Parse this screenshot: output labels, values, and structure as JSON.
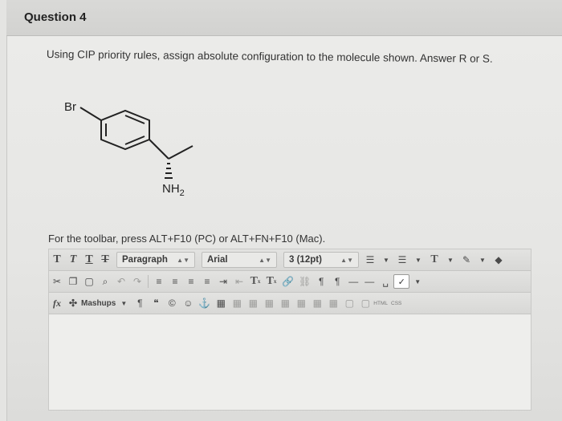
{
  "question": {
    "title": "Question 4",
    "text": "Using CIP priority rules, assign absolute configuration to the molecule shown. Answer R or S."
  },
  "molecule": {
    "labels": {
      "br": "Br",
      "nh2": "NH",
      "nh2_sub": "2"
    }
  },
  "editor": {
    "toolbar_hint": "For the toolbar, press ALT+F10 (PC) or ALT+FN+F10 (Mac).",
    "row1": {
      "format_buttons": [
        "T",
        "T",
        "T",
        "T"
      ],
      "paragraph": "Paragraph",
      "font": "Arial",
      "size": "3 (12pt)",
      "text_color_label": "T"
    },
    "row2": {
      "superscript": "T",
      "subscript": "T"
    },
    "row3": {
      "fx": "fx",
      "mashups": "Mashups",
      "html_label": "HTML",
      "css_label": "CSS"
    }
  }
}
